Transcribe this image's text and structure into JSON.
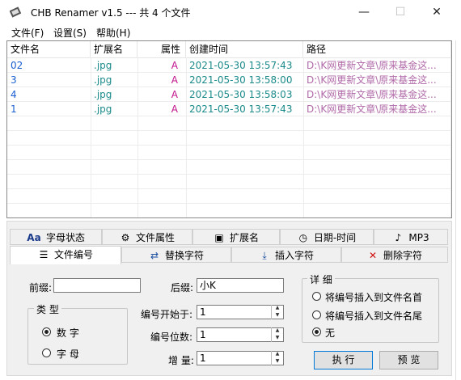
{
  "window": {
    "title": "CHB Renamer v1.5 --- 共 4 个文件",
    "minimize": "—",
    "maximize": "☐",
    "close": "✕"
  },
  "menu": [
    "文件(F)",
    "设置(S)",
    "帮助(H)"
  ],
  "list": {
    "columns": [
      "文件名",
      "扩展名",
      "属性",
      "创建时间",
      "路径"
    ],
    "rows": [
      {
        "name": "02",
        "ext": ".jpg",
        "attr": "A",
        "created": "2021-05-30 13:57:43",
        "path": "D:\\K网更新文章\\原来基金这..."
      },
      {
        "name": "3",
        "ext": ".jpg",
        "attr": "A",
        "created": "2021-05-30 13:58:00",
        "path": "D:\\K网更新文章\\原来基金这..."
      },
      {
        "name": "4",
        "ext": ".jpg",
        "attr": "A",
        "created": "2021-05-30 13:58:03",
        "path": "D:\\K网更新文章\\原来基金这..."
      },
      {
        "name": "1",
        "ext": ".jpg",
        "attr": "A",
        "created": "2021-05-30 13:57:43",
        "path": "D:\\K网更新文章\\原来基金这..."
      }
    ]
  },
  "tabs_row1": [
    {
      "label": "字母状态",
      "icon": "Aa"
    },
    {
      "label": "文件属性",
      "icon": "⚙"
    },
    {
      "label": "扩展名",
      "icon": "▣"
    },
    {
      "label": "日期-时间",
      "icon": "◷"
    },
    {
      "label": "MP3",
      "icon": "♪"
    }
  ],
  "tabs_row2": [
    {
      "label": "文件编号",
      "icon": "☰"
    },
    {
      "label": "替换字符",
      "icon": "⇄"
    },
    {
      "label": "插入字符",
      "icon": "⤓"
    },
    {
      "label": "删除字符",
      "icon": "✕"
    }
  ],
  "form": {
    "prefix_label": "前缀:",
    "prefix_value": "",
    "suffix_label": "后缀:",
    "suffix_value": "小K",
    "type_group": "类 型",
    "type_number": "数 字",
    "type_letter": "字 母",
    "start_label": "编号开始于:",
    "start_value": "1",
    "digits_label": "编号位数:",
    "digits_value": "1",
    "step_label": "增 量:",
    "step_value": "1"
  },
  "detail": {
    "title": "详 细",
    "opt_front": "将编号插入到文件名首",
    "opt_end": "将编号插入到文件名尾",
    "opt_none": "无"
  },
  "buttons": {
    "run": "执 行",
    "preview": "预 览"
  },
  "colors": {
    "name": "#1a5fd0",
    "ext": "#1b8a8a",
    "attr": "#c0148c",
    "created": "#1b8a8a",
    "path": "#b06aa8",
    "tab_close_icon": "#d01010"
  }
}
